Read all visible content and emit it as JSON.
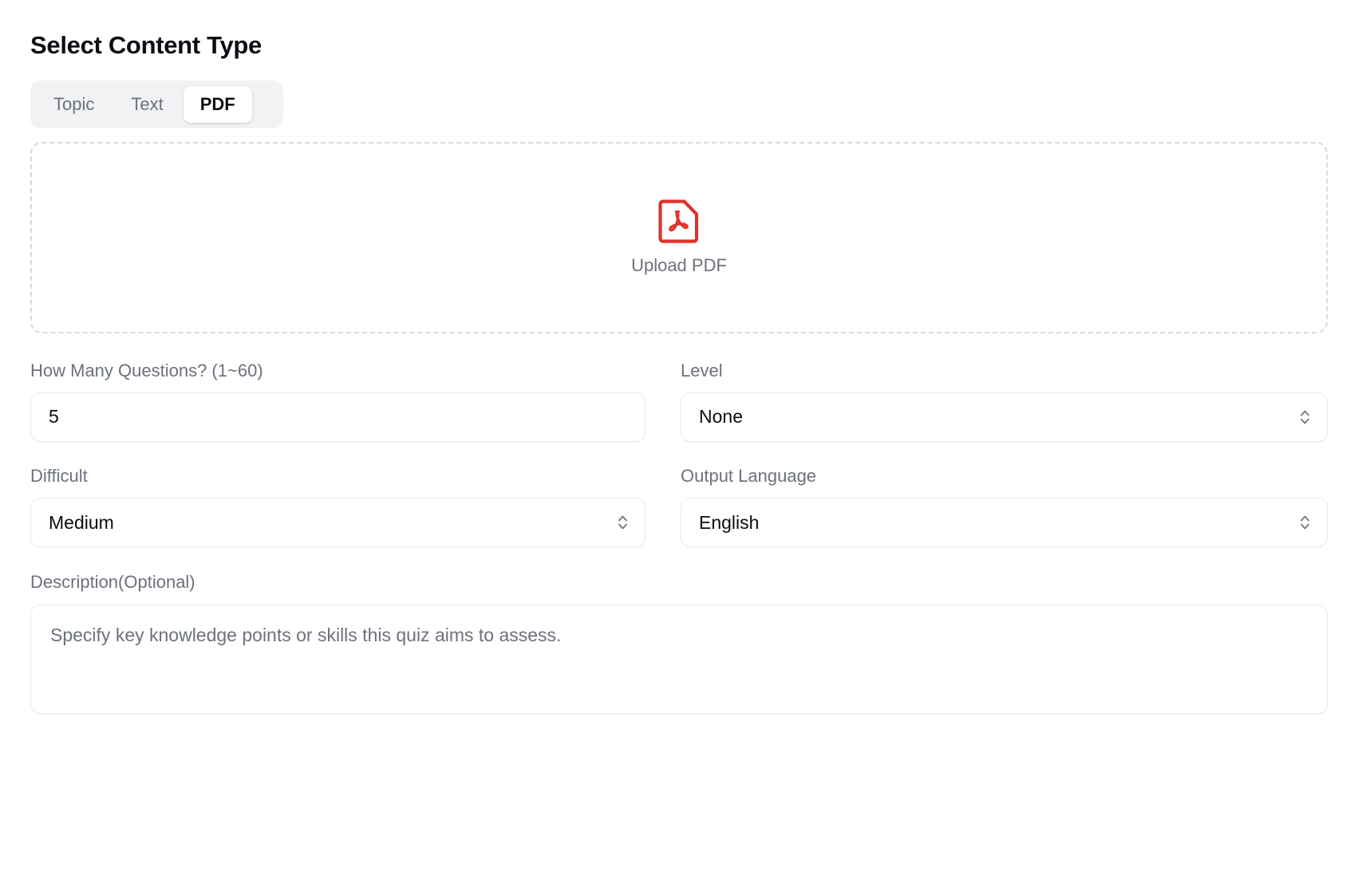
{
  "page": {
    "title": "Select Content Type"
  },
  "content_type_tabs": {
    "items": [
      {
        "label": "Topic",
        "active": false
      },
      {
        "label": "Text",
        "active": false
      },
      {
        "label": "PDF",
        "active": true
      }
    ]
  },
  "upload": {
    "label": "Upload PDF",
    "icon": "pdf-file-icon",
    "icon_color": "#e0312a",
    "border_color": "#d7d9dd"
  },
  "fields": {
    "question_count": {
      "label": "How Many Questions? (1~60)",
      "value": "5"
    },
    "level": {
      "label": "Level",
      "value": "None",
      "icon": "chevron-up-down-icon"
    },
    "difficulty": {
      "label": "Difficult",
      "value": "Medium",
      "icon": "chevron-up-down-icon"
    },
    "output_language": {
      "label": "Output Language",
      "value": "English",
      "icon": "chevron-up-down-icon"
    },
    "description": {
      "label": "Description(Optional)",
      "value": "",
      "placeholder": "Specify key knowledge points or skills this quiz aims to assess."
    }
  },
  "colors": {
    "text_primary": "#0b0d12",
    "text_muted": "#6d717c",
    "segment_background": "#f1f2f4",
    "border": "#e8eaed"
  }
}
